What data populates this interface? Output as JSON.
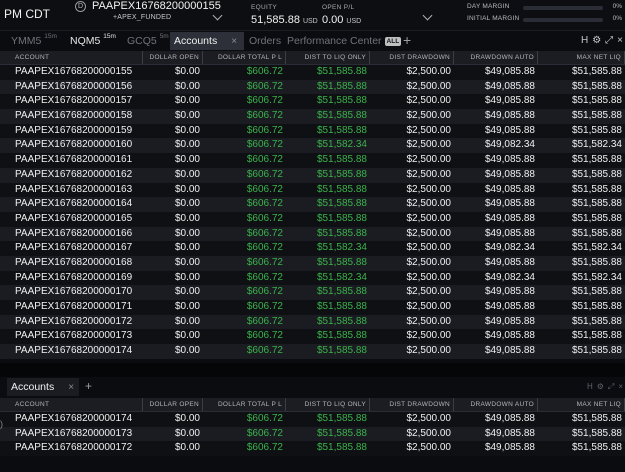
{
  "topbar": {
    "time_label": "PM CDT",
    "account_circle": "D",
    "account_name": "PAAPEX16768200000155",
    "account_sub": "+APEX_FUNDED",
    "equity_label": "EQUITY",
    "equity_value": "51,585.88",
    "equity_unit": "USD",
    "openpl_label": "OPEN P/L",
    "openpl_value": "0.00",
    "openpl_unit": "USD",
    "day_margin_label": "DAY MARGIN",
    "day_margin_pct": "0%",
    "day_margin_fraction": 0,
    "initial_margin_label": "INITIAL MARGIN",
    "initial_margin_pct": "0%",
    "initial_margin_fraction": 0
  },
  "tabs": [
    {
      "label": "YMM5",
      "sup": "15m"
    },
    {
      "label": "NQM5",
      "sup": "15m"
    },
    {
      "label": "GCQ5",
      "sup": "5m"
    },
    {
      "label": "Accounts",
      "close": "×"
    },
    {
      "label": "Orders"
    },
    {
      "label": "Performance Center",
      "badge": "ALL"
    }
  ],
  "tabbar_plus": "+",
  "icons": {
    "h": "H",
    "gear": "⚙",
    "expand": "⤢",
    "close": "×"
  },
  "columns": [
    "ACCOUNT",
    "DOLLAR OPEN",
    "DOLLAR TOTAL P L",
    "DIST TO LIQ ONLY",
    "DIST DRAWDOWN",
    "DRAWDOWN AUTO",
    "MAX NET LIQ"
  ],
  "rows": [
    [
      "PAAPEX16768200000155",
      "$0.00",
      "$606.72",
      "$51,585.88",
      "$2,500.00",
      "$49,085.88",
      "$51,585.88"
    ],
    [
      "PAAPEX16768200000156",
      "$0.00",
      "$606.72",
      "$51,585.88",
      "$2,500.00",
      "$49,085.88",
      "$51,585.88"
    ],
    [
      "PAAPEX16768200000157",
      "$0.00",
      "$606.72",
      "$51,585.88",
      "$2,500.00",
      "$49,085.88",
      "$51,585.88"
    ],
    [
      "PAAPEX16768200000158",
      "$0.00",
      "$606.72",
      "$51,585.88",
      "$2,500.00",
      "$49,085.88",
      "$51,585.88"
    ],
    [
      "PAAPEX16768200000159",
      "$0.00",
      "$606.72",
      "$51,585.88",
      "$2,500.00",
      "$49,085.88",
      "$51,585.88"
    ],
    [
      "PAAPEX16768200000160",
      "$0.00",
      "$606.72",
      "$51,582.34",
      "$2,500.00",
      "$49,082.34",
      "$51,582.34"
    ],
    [
      "PAAPEX16768200000161",
      "$0.00",
      "$606.72",
      "$51,585.88",
      "$2,500.00",
      "$49,085.88",
      "$51,585.88"
    ],
    [
      "PAAPEX16768200000162",
      "$0.00",
      "$606.72",
      "$51,585.88",
      "$2,500.00",
      "$49,085.88",
      "$51,585.88"
    ],
    [
      "PAAPEX16768200000163",
      "$0.00",
      "$606.72",
      "$51,585.88",
      "$2,500.00",
      "$49,085.88",
      "$51,585.88"
    ],
    [
      "PAAPEX16768200000164",
      "$0.00",
      "$606.72",
      "$51,585.88",
      "$2,500.00",
      "$49,085.88",
      "$51,585.88"
    ],
    [
      "PAAPEX16768200000165",
      "$0.00",
      "$606.72",
      "$51,585.88",
      "$2,500.00",
      "$49,085.88",
      "$51,585.88"
    ],
    [
      "PAAPEX16768200000166",
      "$0.00",
      "$606.72",
      "$51,585.88",
      "$2,500.00",
      "$49,085.88",
      "$51,585.88"
    ],
    [
      "PAAPEX16768200000167",
      "$0.00",
      "$606.72",
      "$51,582.34",
      "$2,500.00",
      "$49,082.34",
      "$51,582.34"
    ],
    [
      "PAAPEX16768200000168",
      "$0.00",
      "$606.72",
      "$51,585.88",
      "$2,500.00",
      "$49,085.88",
      "$51,585.88"
    ],
    [
      "PAAPEX16768200000169",
      "$0.00",
      "$606.72",
      "$51,582.34",
      "$2,500.00",
      "$49,082.34",
      "$51,582.34"
    ],
    [
      "PAAPEX16768200000170",
      "$0.00",
      "$606.72",
      "$51,585.88",
      "$2,500.00",
      "$49,085.88",
      "$51,585.88"
    ],
    [
      "PAAPEX16768200000171",
      "$0.00",
      "$606.72",
      "$51,585.88",
      "$2,500.00",
      "$49,085.88",
      "$51,585.88"
    ],
    [
      "PAAPEX16768200000172",
      "$0.00",
      "$606.72",
      "$51,585.88",
      "$2,500.00",
      "$49,085.88",
      "$51,585.88"
    ],
    [
      "PAAPEX16768200000173",
      "$0.00",
      "$606.72",
      "$51,585.88",
      "$2,500.00",
      "$49,085.88",
      "$51,585.88"
    ],
    [
      "PAAPEX16768200000174",
      "$0.00",
      "$606.72",
      "$51,585.88",
      "$2,500.00",
      "$49,085.88",
      "$51,585.88"
    ]
  ],
  "bottom_panel": {
    "tab_label": "Accounts",
    "tab_close": "×",
    "plus": "+",
    "rows": [
      [
        "PAAPEX16768200000174",
        "$0.00",
        "$606.72",
        "$51,585.88",
        "$2,500.00",
        "$49,085.88",
        "$51,585.88"
      ],
      [
        "PAAPEX16768200000173",
        "$0.00",
        "$606.72",
        "$51,585.88",
        "$2,500.00",
        "$49,085.88",
        "$51,585.88"
      ],
      [
        "PAAPEX16768200000172",
        "$0.00",
        "$606.72",
        "$51,585.88",
        "$2,500.00",
        "$49,085.88",
        "$51,585.88"
      ]
    ]
  },
  "colors": {
    "positive": "#3bb34a",
    "tab_active_bg": "#2d3038"
  }
}
